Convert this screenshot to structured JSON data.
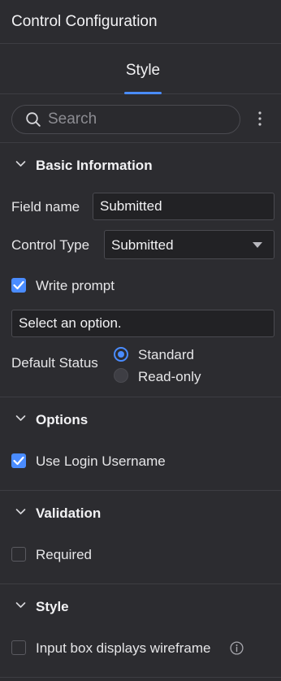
{
  "header": {
    "title": "Control Configuration"
  },
  "tabs": [
    {
      "label": "Style",
      "active": true
    }
  ],
  "search": {
    "placeholder": "Search",
    "value": ""
  },
  "sections": {
    "basic": {
      "title": "Basic Information",
      "field_name_label": "Field name",
      "field_name_value": "Submitted",
      "control_type_label": "Control Type",
      "control_type_value": "Submitted",
      "write_prompt_label": "Write prompt",
      "write_prompt_checked": true,
      "prompt_value": "Select an option.",
      "default_status_label": "Default Status",
      "default_status_options": [
        "Standard",
        "Read-only"
      ],
      "default_status_selected": "Standard"
    },
    "options": {
      "title": "Options",
      "use_login_username_label": "Use Login Username",
      "use_login_username_checked": true
    },
    "validation": {
      "title": "Validation",
      "required_label": "Required",
      "required_checked": false
    },
    "style": {
      "title": "Style",
      "wireframe_label": "Input box displays wireframe",
      "wireframe_checked": false
    }
  },
  "colors": {
    "background": "#2c2c30",
    "accent": "#4a8cff",
    "divider": "#3d3d42"
  }
}
